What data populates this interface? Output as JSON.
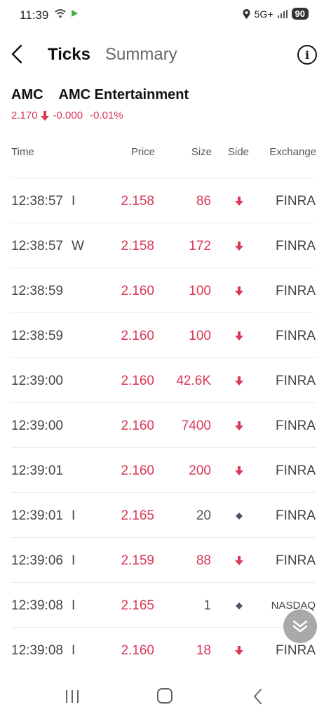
{
  "status_bar": {
    "time": "11:39",
    "network": "5G+",
    "battery": "90"
  },
  "header": {
    "tab_ticks": "Ticks",
    "tab_summary": "Summary",
    "info_label": "i"
  },
  "quote": {
    "symbol": "AMC",
    "name": "AMC Entertainment",
    "price": "2.170",
    "change": "-0.000",
    "change_pct": "-0.01%",
    "color_down": "#d93a58"
  },
  "columns": {
    "time": "Time",
    "price": "Price",
    "size": "Size",
    "side": "Side",
    "exchange": "Exchange"
  },
  "rows": [
    {
      "time": "12:38:57",
      "cond": "I",
      "price": "2.158",
      "size": "86",
      "side": "down",
      "exchange": "FINRA"
    },
    {
      "time": "12:38:57",
      "cond": "W",
      "price": "2.158",
      "size": "172",
      "side": "down",
      "exchange": "FINRA"
    },
    {
      "time": "12:38:59",
      "cond": "",
      "price": "2.160",
      "size": "100",
      "side": "down",
      "exchange": "FINRA"
    },
    {
      "time": "12:38:59",
      "cond": "",
      "price": "2.160",
      "size": "100",
      "side": "down",
      "exchange": "FINRA"
    },
    {
      "time": "12:39:00",
      "cond": "",
      "price": "2.160",
      "size": "42.6K",
      "side": "down",
      "exchange": "FINRA"
    },
    {
      "time": "12:39:00",
      "cond": "",
      "price": "2.160",
      "size": "7400",
      "side": "down",
      "exchange": "FINRA"
    },
    {
      "time": "12:39:01",
      "cond": "",
      "price": "2.160",
      "size": "200",
      "side": "down",
      "exchange": "FINRA"
    },
    {
      "time": "12:39:01",
      "cond": "I",
      "price": "2.165",
      "size": "20",
      "side": "neutral",
      "exchange": "FINRA"
    },
    {
      "time": "12:39:06",
      "cond": "I",
      "price": "2.159",
      "size": "88",
      "side": "down",
      "exchange": "FINRA"
    },
    {
      "time": "12:39:08",
      "cond": "I",
      "price": "2.165",
      "size": "1",
      "side": "neutral",
      "exchange": "NASDAQ"
    },
    {
      "time": "12:39:08",
      "cond": "I",
      "price": "2.160",
      "size": "18",
      "side": "down",
      "exchange": "FINRA"
    }
  ],
  "icons": {
    "back": "back-arrow-icon",
    "info": "info-icon",
    "scroll": "scroll-down-icon",
    "side_down": "down-arrow-icon",
    "side_neutral": "diamond-icon"
  }
}
